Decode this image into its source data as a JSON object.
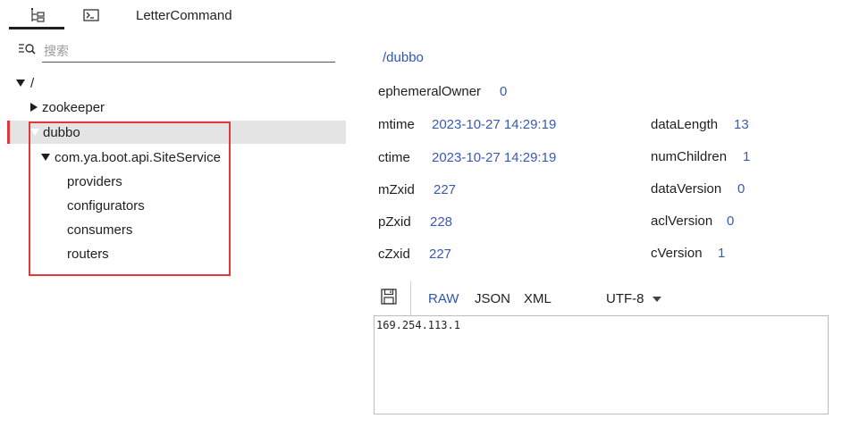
{
  "tabs": {
    "tree_icon": "tree-list-icon",
    "terminal_icon": "terminal-icon",
    "letter_command": "LetterCommand"
  },
  "search": {
    "placeholder": "搜索",
    "value": ""
  },
  "tree": {
    "root": "/",
    "zookeeper": "zookeeper",
    "dubbo": "dubbo",
    "service": "com.ya.boot.api.SiteService",
    "children": [
      "providers",
      "configurators",
      "consumers",
      "routers"
    ]
  },
  "detail": {
    "path": "/dubbo",
    "ephemeralOwner": {
      "label": "ephemeralOwner",
      "value": "0"
    },
    "mtime": {
      "label": "mtime",
      "value": "2023-10-27 14:29:19"
    },
    "ctime": {
      "label": "ctime",
      "value": "2023-10-27 14:29:19"
    },
    "mZxid": {
      "label": "mZxid",
      "value": "227"
    },
    "pZxid": {
      "label": "pZxid",
      "value": "228"
    },
    "cZxid": {
      "label": "cZxid",
      "value": "227"
    },
    "dataLength": {
      "label": "dataLength",
      "value": "13"
    },
    "numChildren": {
      "label": "numChildren",
      "value": "1"
    },
    "dataVersion": {
      "label": "dataVersion",
      "value": "0"
    },
    "aclVersion": {
      "label": "aclVersion",
      "value": "0"
    },
    "cVersion": {
      "label": "cVersion",
      "value": "1"
    }
  },
  "toolbar": {
    "save_icon": "save-icon",
    "raw": "RAW",
    "json": "JSON",
    "xml": "XML",
    "encoding": "UTF-8"
  },
  "data_content": "169.254.113.1",
  "colors": {
    "accent": "#2f55b3",
    "value_text": "#3a5ab0",
    "highlight_red": "#e03a3a",
    "selected_bg": "#e4e4e4"
  }
}
